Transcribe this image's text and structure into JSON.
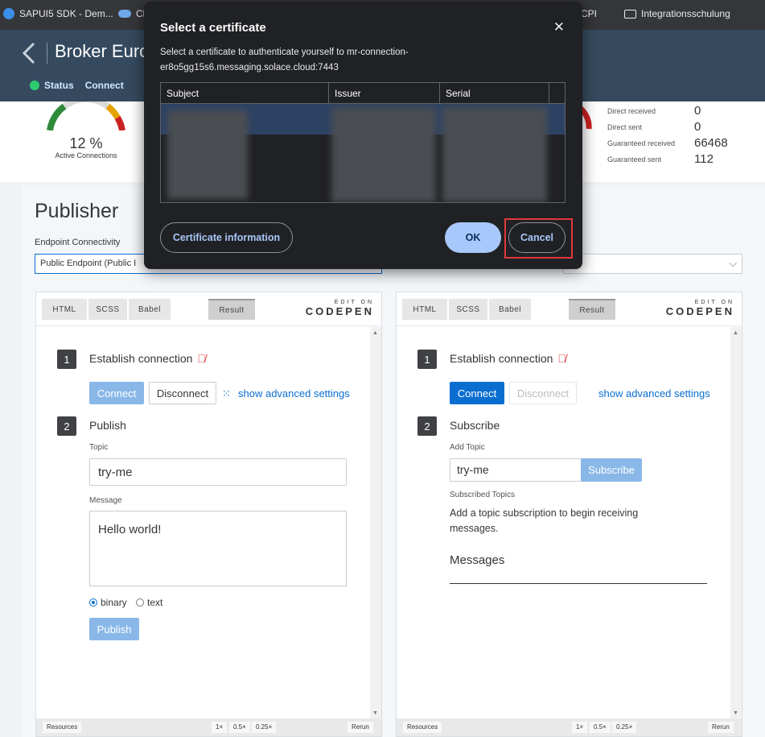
{
  "bookmarks": [
    {
      "label": "SAPUI5 SDK - Dem...",
      "icon": "sap-favicon-icon"
    },
    {
      "label": "Cl",
      "icon": "cloud-icon"
    },
    {
      "label": "CPI",
      "icon": "folder-icon"
    },
    {
      "label": "Integrationsschulung",
      "icon": "folder-icon"
    }
  ],
  "shell": {
    "title": "Broker Euro",
    "tabs": [
      {
        "label": "Status"
      },
      {
        "label": "Connect"
      }
    ]
  },
  "metrics": {
    "gauge_value": "12 %",
    "gauge_label": "Active Connections",
    "stats": [
      {
        "label": "Direct received",
        "value": "0"
      },
      {
        "label": "Direct sent",
        "value": "0"
      },
      {
        "label": "Guaranteed received",
        "value": "66468"
      },
      {
        "label": "Guaranteed sent",
        "value": "112"
      }
    ]
  },
  "publisher": {
    "title": "Publisher",
    "endpoint_label": "Endpoint Connectivity",
    "endpoint_value": "Public Endpoint  (Public I"
  },
  "codepen": {
    "tabs": [
      "HTML",
      "SCSS",
      "Babel",
      "Result"
    ],
    "logo_edit": "EDIT ON",
    "logo_name": "CODEPEN",
    "footer": {
      "resources": "Resources",
      "zoom1": "1×",
      "zoom05": "0.5×",
      "zoom025": "0.25×",
      "rerun": "Rerun"
    }
  },
  "left_pen": {
    "step1_num": "1",
    "step1_title": "Establish connection",
    "connect": "Connect",
    "disconnect": "Disconnect",
    "advanced": "show advanced settings",
    "step2_num": "2",
    "step2_title": "Publish",
    "topic_label": "Topic",
    "topic_value": "try-me",
    "message_label": "Message",
    "message_value": "Hello world!",
    "radio_binary": "binary",
    "radio_text": "text",
    "publish": "Publish"
  },
  "right_pen": {
    "step1_num": "1",
    "step1_title": "Establish connection",
    "connect": "Connect",
    "disconnect": "Disconnect",
    "advanced": "show advanced settings",
    "step2_num": "2",
    "step2_title": "Subscribe",
    "add_topic_label": "Add Topic",
    "topic_value": "try-me",
    "subscribe": "Subscribe",
    "subscribed_label": "Subscribed Topics",
    "hint": "Add a topic subscription to begin receiving messages.",
    "messages_title": "Messages"
  },
  "dialog": {
    "title": "Select a certificate",
    "description": "Select a certificate to authenticate yourself to mr-connection-er8o5gg15s6.messaging.solace.cloud:7443",
    "columns": [
      "Subject",
      "Issuer",
      "Serial"
    ],
    "cert_info_button": "Certificate information",
    "ok_button": "OK",
    "cancel_button": "Cancel"
  },
  "colors": {
    "shell": "#354a5f",
    "accent": "#0a6ed1",
    "dialog_bg": "#202124",
    "highlight": "#e0393b"
  }
}
